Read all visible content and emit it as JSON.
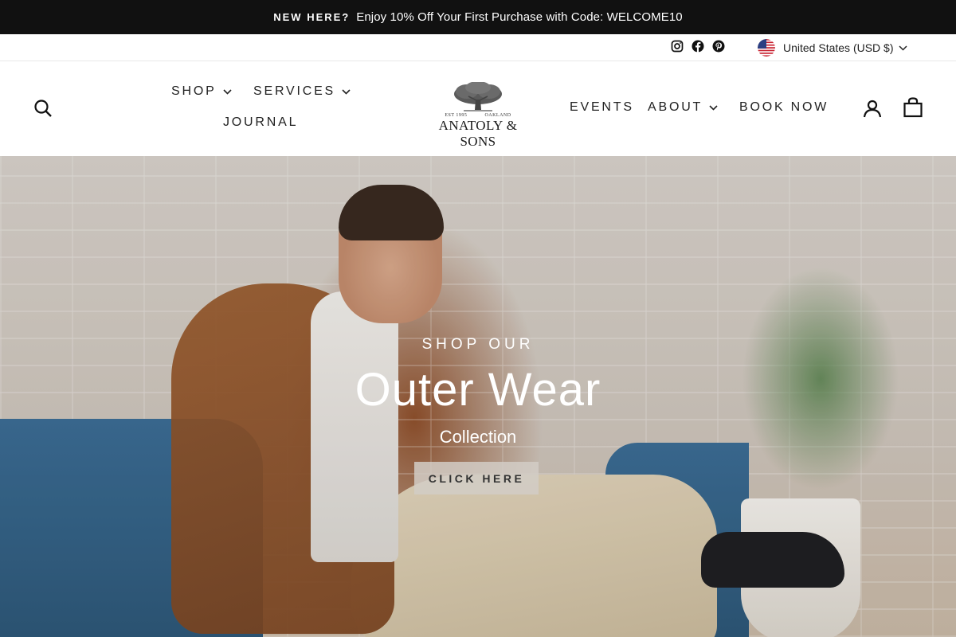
{
  "announcement": {
    "label": "NEW HERE?",
    "message": "Enjoy 10% Off Your First Purchase with Code: WELCOME10"
  },
  "utility": {
    "social_icons": [
      "instagram-icon",
      "facebook-icon",
      "pinterest-icon"
    ],
    "locale_label": "United States (USD $)",
    "flag_icon": "us-flag-icon"
  },
  "nav": {
    "left": [
      {
        "label": "SHOP",
        "has_dropdown": true
      },
      {
        "label": "SERVICES",
        "has_dropdown": true
      },
      {
        "label": "JOURNAL",
        "has_dropdown": false
      }
    ],
    "right": [
      {
        "label": "EVENTS",
        "has_dropdown": false
      },
      {
        "label": "ABOUT",
        "has_dropdown": true
      },
      {
        "label": "BOOK NOW",
        "has_dropdown": false
      }
    ],
    "icons": [
      "search-icon",
      "account-icon",
      "cart-icon"
    ]
  },
  "logo": {
    "est": "EST 1995",
    "city": "OAKLAND",
    "name": "ANATOLY & SONS"
  },
  "hero": {
    "eyebrow": "SHOP OUR",
    "headline": "Outer Wear",
    "subheadline": "Collection",
    "cta_label": "CLICK HERE"
  },
  "colors": {
    "announcement_bg": "#111111",
    "text": "#222222",
    "cta_bg": "#d2cdc6"
  }
}
